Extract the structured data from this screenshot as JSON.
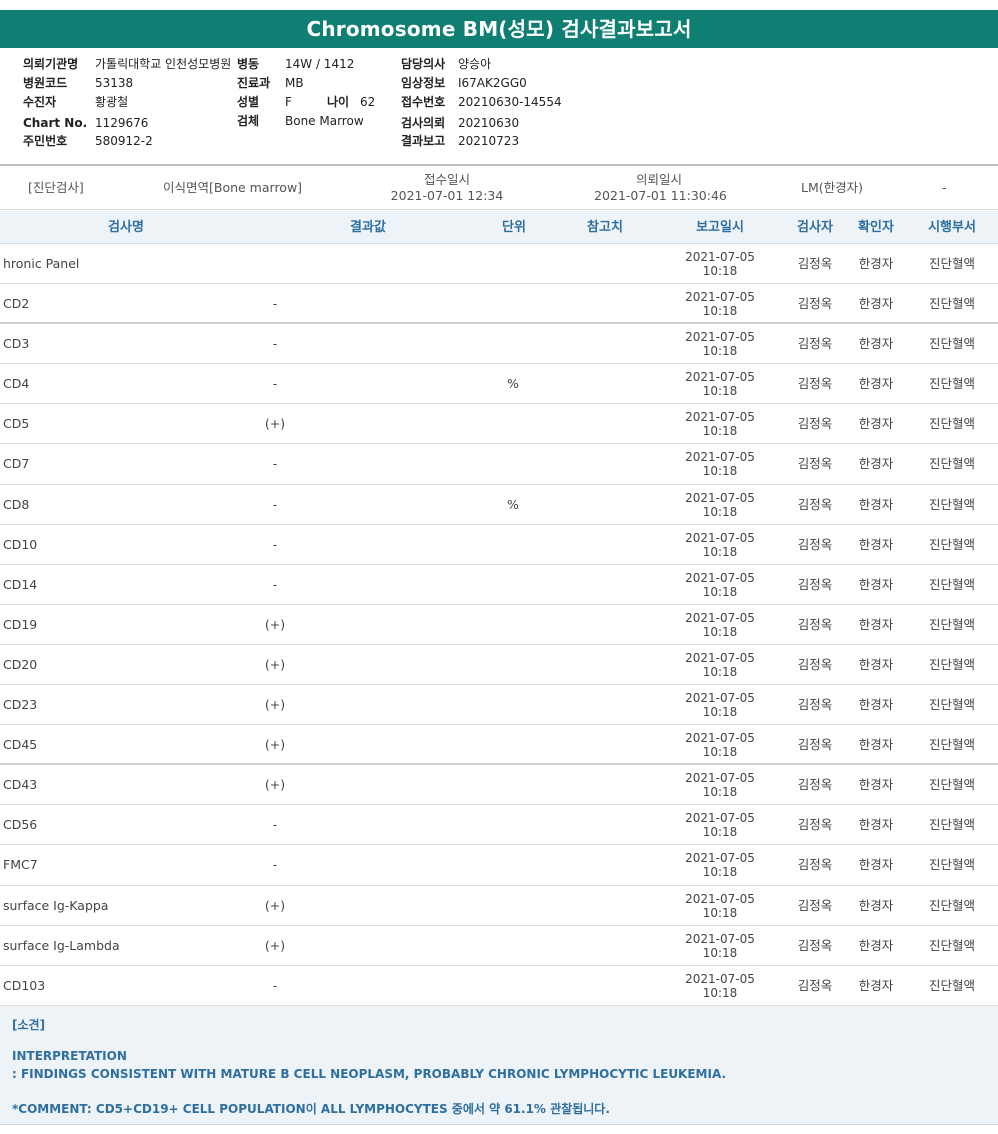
{
  "report_title": "Chromosome BM(성모) 검사결과보고서",
  "patient": {
    "institution_label": "의뢰기관명",
    "institution": "가톨릭대학교 인천성모병원",
    "ward_label": "병동",
    "ward": "14W / 1412",
    "doctor_label": "담당의사",
    "doctor": "양승아",
    "hospital_code_label": "병원코드",
    "hospital_code": "53138",
    "department_label": "진료과",
    "department": "MB",
    "clinical_info_label": "임상정보",
    "clinical_info": "I67AK2GG0",
    "patient_label": "수진자",
    "patient_name": "황광철",
    "sex_label": "성별",
    "sex": "F",
    "age_label": "나이",
    "age": "62",
    "receipt_no_label": "접수번호",
    "receipt_no": "20210630-14554",
    "chart_no_label": "Chart No.",
    "chart_no": "1129676",
    "specimen_label": "검체",
    "specimen": "Bone Marrow",
    "test_request_label": "검사의뢰",
    "test_request": "20210630",
    "resident_no_label": "주민번호",
    "resident_no": "580912-2",
    "result_report_label": "결과보고",
    "result_report": "20210723"
  },
  "order": {
    "category": "[진단검사]",
    "specimen": "이식면역[Bone marrow]",
    "received_label": "접수일시",
    "received": "2021-07-01 12:34",
    "requested_label": "의뢰일시",
    "requested": "2021-07-01 11:30:46",
    "lab": "LM(한경자)",
    "extra": "-"
  },
  "table": {
    "headers": {
      "name": "검사명",
      "result": "결과값",
      "unit": "단위",
      "reference": "참고치",
      "report_date": "보고일시",
      "tester": "검사자",
      "confirmer": "확인자",
      "dept": "시행부서"
    },
    "rows": [
      {
        "name": "hronic Panel",
        "result": "",
        "unit": "",
        "date": "2021-07-05",
        "time": "10:18",
        "tester": "김정옥",
        "confirmer": "한경자",
        "dept": "진단혈액"
      },
      {
        "name": "CD2",
        "result": "-",
        "unit": "",
        "date": "2021-07-05",
        "time": "10:18",
        "tester": "김정옥",
        "confirmer": "한경자",
        "dept": "진단혈액"
      },
      {
        "name": "CD3",
        "result": "-",
        "unit": "",
        "date": "2021-07-05",
        "time": "10:18",
        "tester": "김정옥",
        "confirmer": "한경자",
        "dept": "진단혈액"
      },
      {
        "name": "CD4",
        "result": "-",
        "unit": "%",
        "date": "2021-07-05",
        "time": "10:18",
        "tester": "김정옥",
        "confirmer": "한경자",
        "dept": "진단혈액"
      },
      {
        "name": "CD5",
        "result": "(+)",
        "unit": "",
        "date": "2021-07-05",
        "time": "10:18",
        "tester": "김정옥",
        "confirmer": "한경자",
        "dept": "진단혈액"
      },
      {
        "name": "CD7",
        "result": "-",
        "unit": "",
        "date": "2021-07-05",
        "time": "10:18",
        "tester": "김정옥",
        "confirmer": "한경자",
        "dept": "진단혈액"
      },
      {
        "name": "CD8",
        "result": "-",
        "unit": "%",
        "date": "2021-07-05",
        "time": "10:18",
        "tester": "김정옥",
        "confirmer": "한경자",
        "dept": "진단혈액"
      },
      {
        "name": "CD10",
        "result": "-",
        "unit": "",
        "date": "2021-07-05",
        "time": "10:18",
        "tester": "김정옥",
        "confirmer": "한경자",
        "dept": "진단혈액"
      },
      {
        "name": "CD14",
        "result": "-",
        "unit": "",
        "date": "2021-07-05",
        "time": "10:18",
        "tester": "김정옥",
        "confirmer": "한경자",
        "dept": "진단혈액"
      },
      {
        "name": "CD19",
        "result": "(+)",
        "unit": "",
        "date": "2021-07-05",
        "time": "10:18",
        "tester": "김정옥",
        "confirmer": "한경자",
        "dept": "진단혈액"
      },
      {
        "name": "CD20",
        "result": "(+)",
        "unit": "",
        "date": "2021-07-05",
        "time": "10:18",
        "tester": "김정옥",
        "confirmer": "한경자",
        "dept": "진단혈액"
      },
      {
        "name": "CD23",
        "result": "(+)",
        "unit": "",
        "date": "2021-07-05",
        "time": "10:18",
        "tester": "김정옥",
        "confirmer": "한경자",
        "dept": "진단혈액"
      },
      {
        "name": "CD45",
        "result": "(+)",
        "unit": "",
        "date": "2021-07-05",
        "time": "10:18",
        "tester": "김정옥",
        "confirmer": "한경자",
        "dept": "진단혈액"
      },
      {
        "name": "CD43",
        "result": "(+)",
        "unit": "",
        "date": "2021-07-05",
        "time": "10:18",
        "tester": "김정옥",
        "confirmer": "한경자",
        "dept": "진단혈액"
      },
      {
        "name": "CD56",
        "result": "-",
        "unit": "",
        "date": "2021-07-05",
        "time": "10:18",
        "tester": "김정옥",
        "confirmer": "한경자",
        "dept": "진단혈액"
      },
      {
        "name": "FMC7",
        "result": "-",
        "unit": "",
        "date": "2021-07-05",
        "time": "10:18",
        "tester": "김정옥",
        "confirmer": "한경자",
        "dept": "진단혈액"
      },
      {
        "name": "surface Ig-Kappa",
        "result": "(+)",
        "unit": "",
        "date": "2021-07-05",
        "time": "10:18",
        "tester": "김정옥",
        "confirmer": "한경자",
        "dept": "진단혈액"
      },
      {
        "name": "surface Ig-Lambda",
        "result": "(+)",
        "unit": "",
        "date": "2021-07-05",
        "time": "10:18",
        "tester": "김정옥",
        "confirmer": "한경자",
        "dept": "진단혈액"
      },
      {
        "name": "CD103",
        "result": "-",
        "unit": "",
        "date": "2021-07-05",
        "time": "10:18",
        "tester": "김정옥",
        "confirmer": "한경자",
        "dept": "진단혈액"
      }
    ]
  },
  "comment": {
    "heading": "[소견]",
    "interpretation_label": "INTERPRETATION",
    "interpretation": " : FINDINGS CONSISTENT WITH MATURE B CELL NEOPLASM, PROBABLY CHRONIC LYMPHOCYTIC LEUKEMIA.",
    "comment": "*COMMENT: CD5+CD19+ CELL POPULATION이 ALL LYMPHOCYTES 중에서 약 61.1% 관찰됩니다."
  }
}
